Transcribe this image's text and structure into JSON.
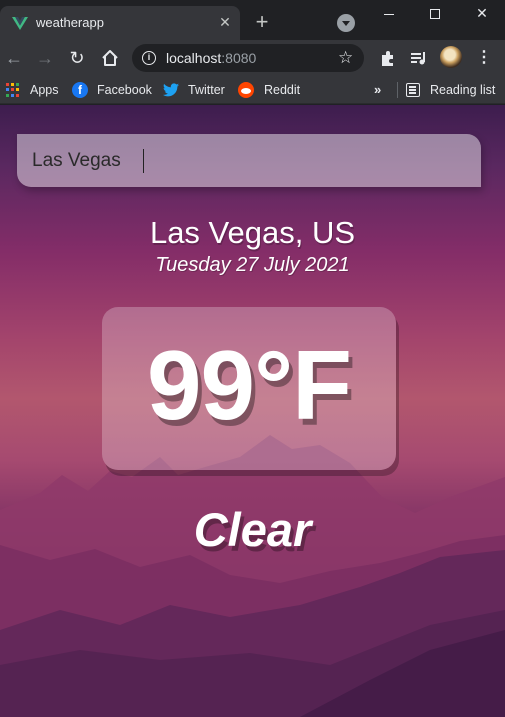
{
  "browser": {
    "tab_title": "weatherapp",
    "url_host": "localhost",
    "url_port": ":8080",
    "bookmarks": [
      {
        "label": "Apps",
        "icon": "apps-grid-icon"
      },
      {
        "label": "Facebook",
        "icon": "facebook-icon"
      },
      {
        "label": "Twitter",
        "icon": "twitter-icon"
      },
      {
        "label": "Reddit",
        "icon": "reddit-icon"
      }
    ],
    "reading_list": "Reading list"
  },
  "search": {
    "value": "Las Vegas"
  },
  "weather": {
    "location": "Las Vegas, US",
    "date": "Tuesday 27 July 2021",
    "temperature": "99°F",
    "condition": "Clear"
  },
  "colors": {
    "vue_green": "#41b883",
    "vue_dark": "#35495e",
    "facebook": "#1877f2",
    "twitter": "#1da1f2",
    "reddit": "#ff4500"
  }
}
